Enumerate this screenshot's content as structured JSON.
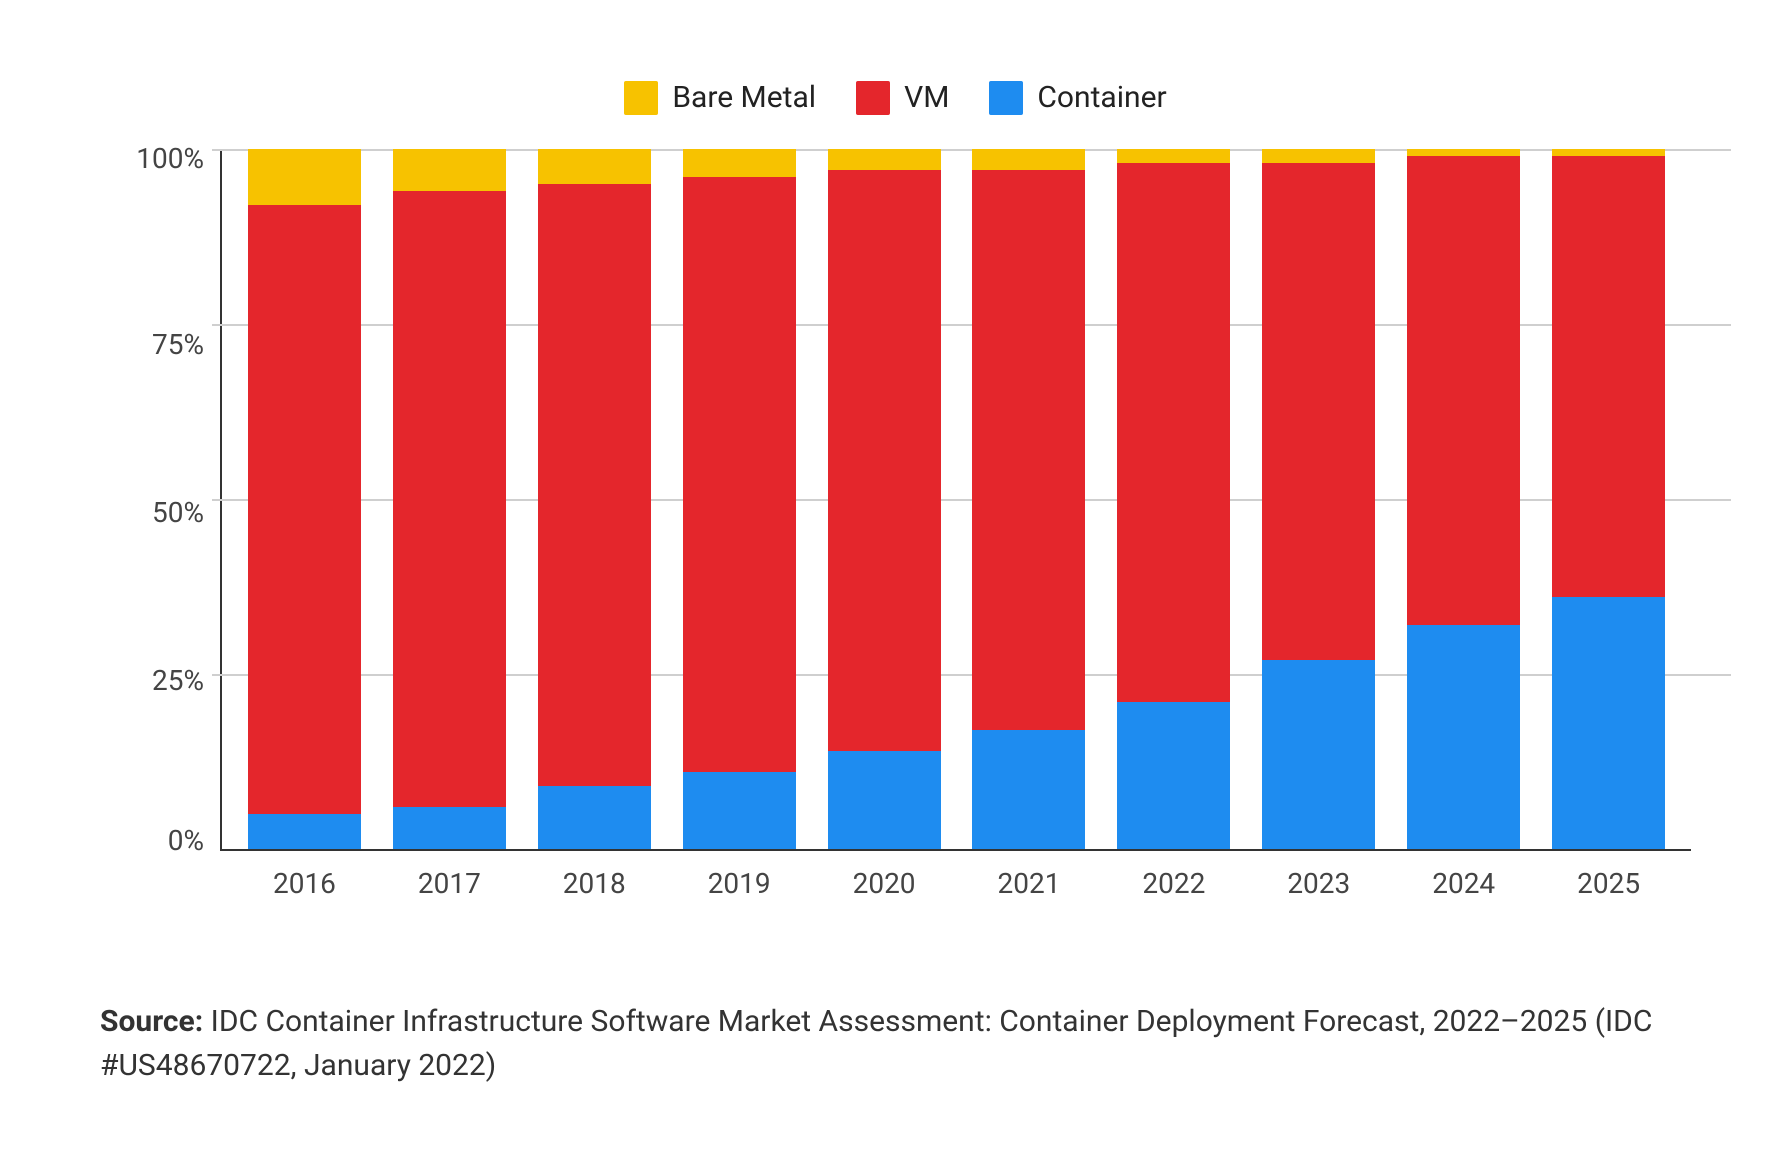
{
  "legend": [
    {
      "name": "Bare Metal",
      "color": "#f7c200"
    },
    {
      "name": "VM",
      "color": "#e4262c"
    },
    {
      "name": "Container",
      "color": "#1e8cf0"
    }
  ],
  "y_ticks": [
    "100%",
    "75%",
    "50%",
    "25%",
    "0%"
  ],
  "categories": [
    "2016",
    "2017",
    "2018",
    "2019",
    "2020",
    "2021",
    "2022",
    "2023",
    "2024",
    "2025"
  ],
  "source_label": "Source:",
  "source_text": "IDC Container Infrastructure Software Market Assessment: Container Deployment Forecast, 2022–2025 (IDC #US48670722, January 2022)",
  "chart_data": {
    "type": "bar",
    "stacked": true,
    "xlabel": "",
    "ylabel": "",
    "ylim": [
      0,
      100
    ],
    "y_unit": "%",
    "categories": [
      "2016",
      "2017",
      "2018",
      "2019",
      "2020",
      "2021",
      "2022",
      "2023",
      "2024",
      "2025"
    ],
    "series": [
      {
        "name": "Container",
        "color": "#1e8cf0",
        "values": [
          5,
          6,
          9,
          11,
          14,
          17,
          21,
          27,
          32,
          36
        ]
      },
      {
        "name": "VM",
        "color": "#e4262c",
        "values": [
          87,
          88,
          86,
          85,
          83,
          80,
          77,
          71,
          67,
          63
        ]
      },
      {
        "name": "Bare Metal",
        "color": "#f7c200",
        "values": [
          8,
          6,
          5,
          4,
          3,
          3,
          2,
          2,
          1,
          1
        ]
      }
    ],
    "legend_position": "top",
    "grid": {
      "y": true,
      "x": false
    },
    "title": ""
  }
}
